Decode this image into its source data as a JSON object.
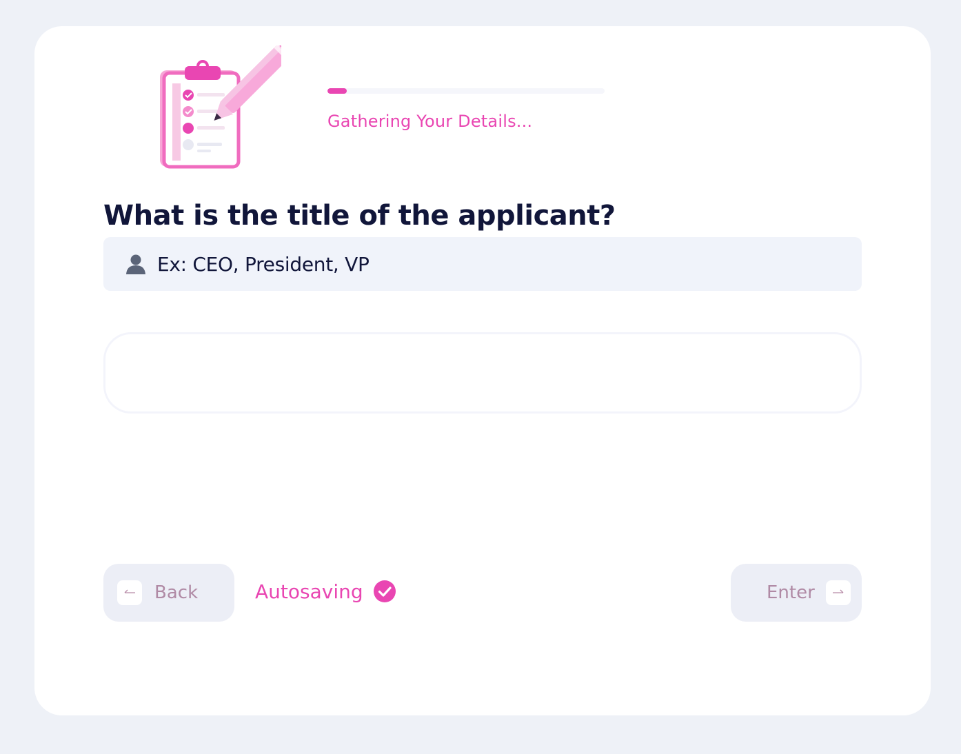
{
  "progress": {
    "label": "Gathering Your Details...",
    "value_percent": 7
  },
  "question": {
    "title": "What is the title of the applicant?",
    "hint_icon": "person-icon",
    "hint": "Ex: CEO, President, VP"
  },
  "answer": {
    "value": "",
    "placeholder": ""
  },
  "footer": {
    "back_label": "Back",
    "back_icon": "arrow-left-icon",
    "autosave_label": "Autosaving",
    "autosave_icon": "check-circle-icon",
    "enter_label": "Enter",
    "enter_icon": "arrow-right-icon"
  },
  "colors": {
    "accent": "#e946b2",
    "text": "#11163a",
    "background": "#eef1f7",
    "hint_background": "#f0f3fa"
  }
}
